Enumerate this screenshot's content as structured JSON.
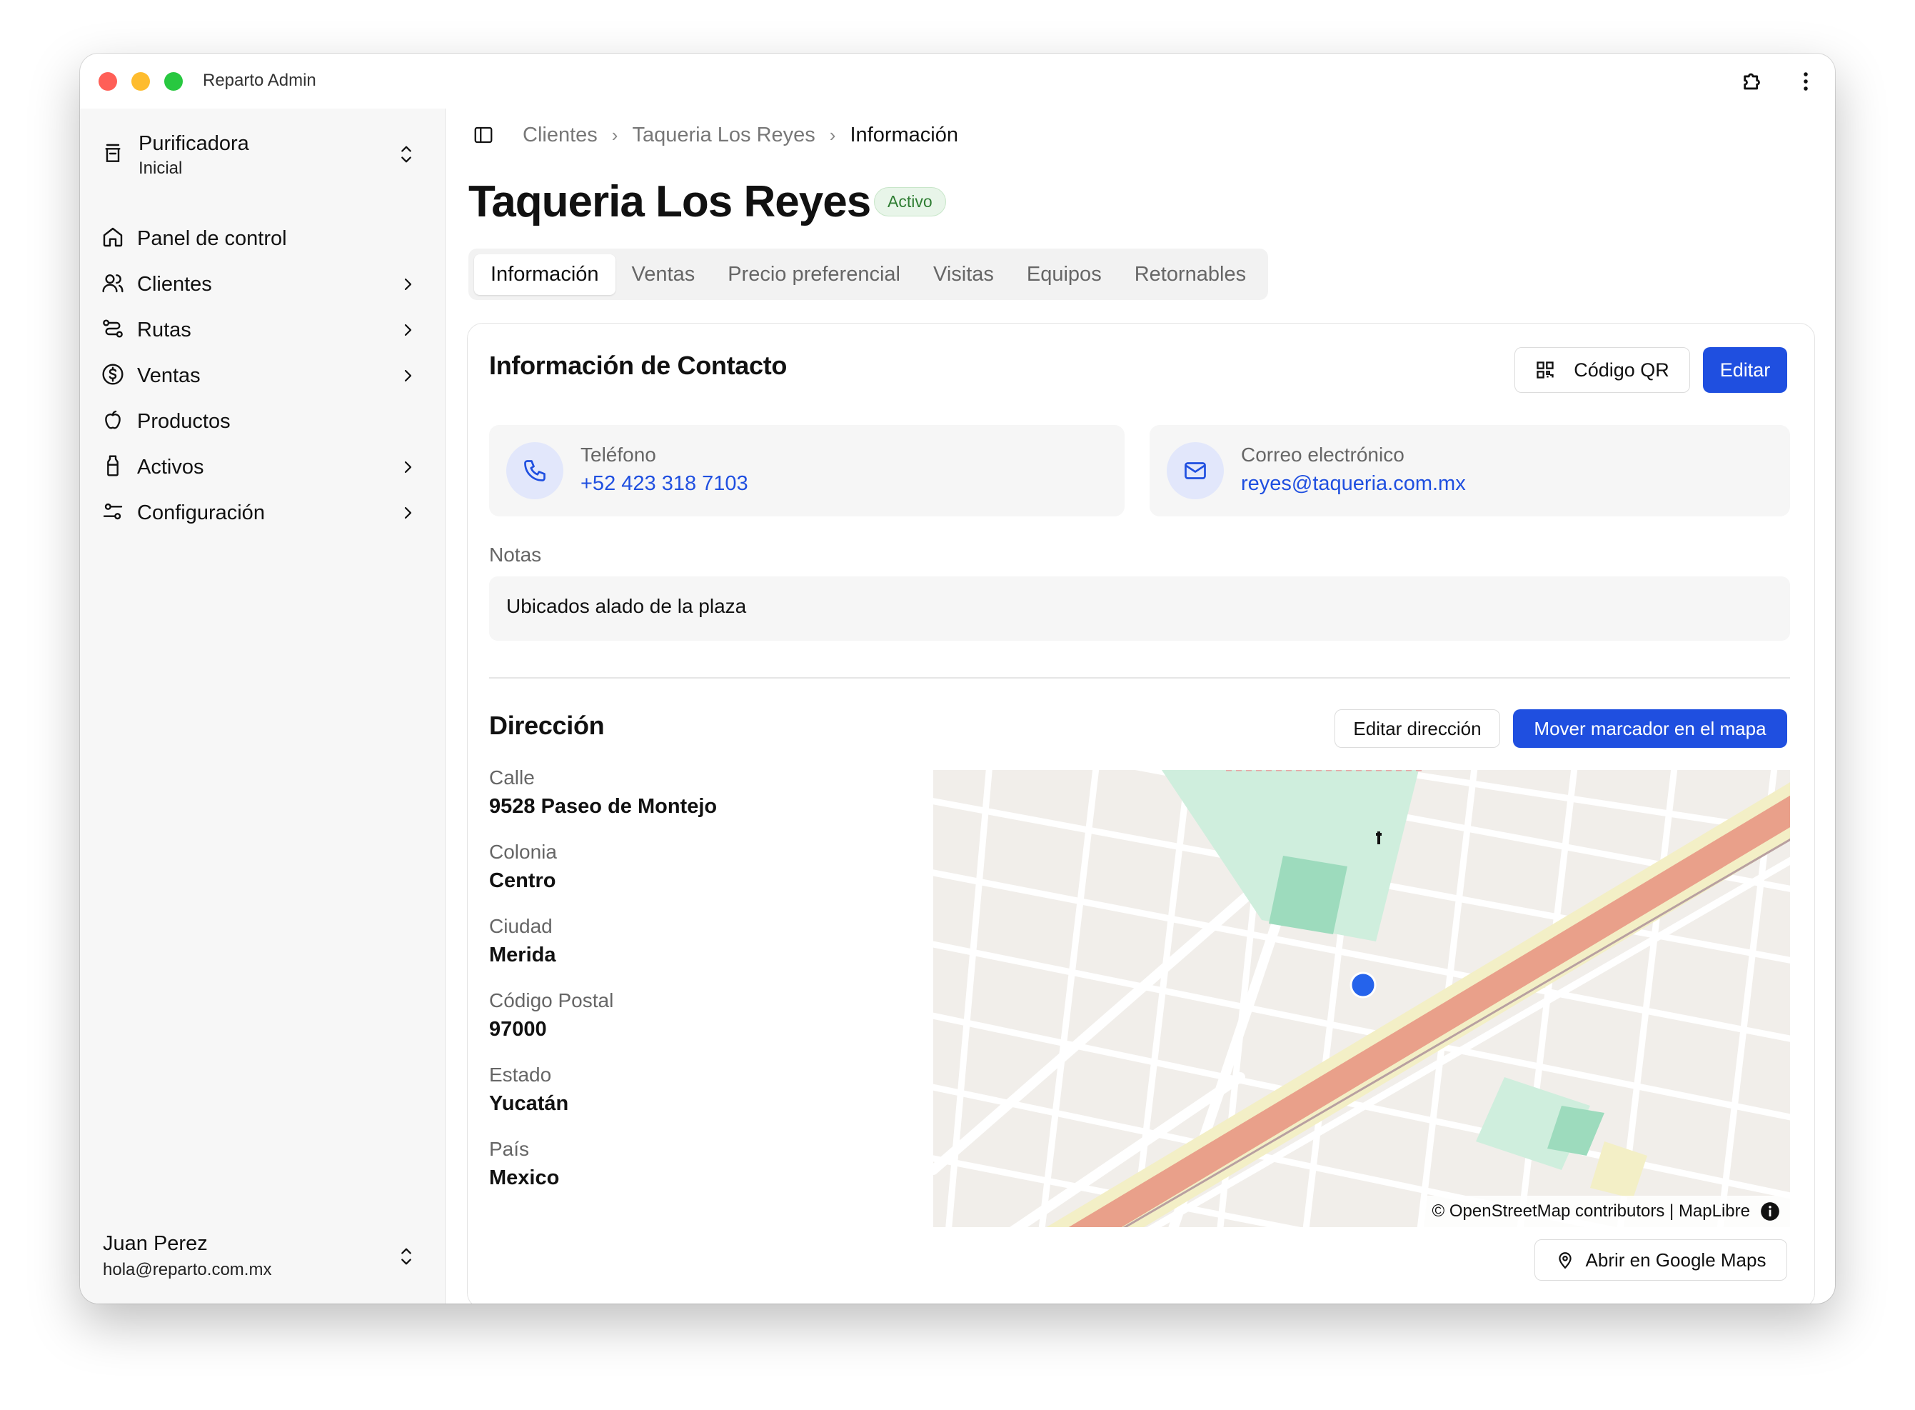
{
  "window": {
    "title": "Reparto Admin"
  },
  "sidebar": {
    "org_name": "Purificadora",
    "org_sub": "Inicial",
    "items": [
      {
        "label": "Panel de control"
      },
      {
        "label": "Clientes"
      },
      {
        "label": "Rutas"
      },
      {
        "label": "Ventas"
      },
      {
        "label": "Productos"
      },
      {
        "label": "Activos"
      },
      {
        "label": "Configuración"
      }
    ],
    "user_name": "Juan Perez",
    "user_email": "hola@reparto.com.mx"
  },
  "breadcrumb": [
    "Clientes",
    "Taqueria Los Reyes",
    "Información"
  ],
  "page": {
    "title": "Taqueria Los Reyes",
    "status": "Activo"
  },
  "tabs": [
    {
      "label": "Información"
    },
    {
      "label": "Ventas"
    },
    {
      "label": "Precio preferencial"
    },
    {
      "label": "Visitas"
    },
    {
      "label": "Equipos"
    },
    {
      "label": "Retornables"
    }
  ],
  "contact": {
    "heading": "Información de Contacto",
    "qr_button": "Código QR",
    "edit_button": "Editar",
    "phone_label": "Teléfono",
    "phone_value": "+52 423 318 7103",
    "email_label": "Correo electrónico",
    "email_value": "reyes@taqueria.com.mx",
    "notes_label": "Notas",
    "notes_value": "Ubicados alado de la plaza"
  },
  "address": {
    "heading": "Dirección",
    "edit_button": "Editar dirección",
    "move_marker_button": "Mover marcador en el mapa",
    "fields": [
      {
        "label": "Calle",
        "value": "9528 Paseo de Montejo"
      },
      {
        "label": "Colonia",
        "value": "Centro"
      },
      {
        "label": "Ciudad",
        "value": "Merida"
      },
      {
        "label": "Código Postal",
        "value": "97000"
      },
      {
        "label": "Estado",
        "value": "Yucatán"
      },
      {
        "label": "País",
        "value": "Mexico"
      }
    ],
    "map_attribution": "© OpenStreetMap contributors | MapLibre",
    "open_maps_button": "Abrir en Google Maps"
  },
  "colors": {
    "accent": "#1f4fe0",
    "status_green": "#2e7d32",
    "road_highlight": "#e9a08a",
    "park_green": "#9ddbbd"
  }
}
